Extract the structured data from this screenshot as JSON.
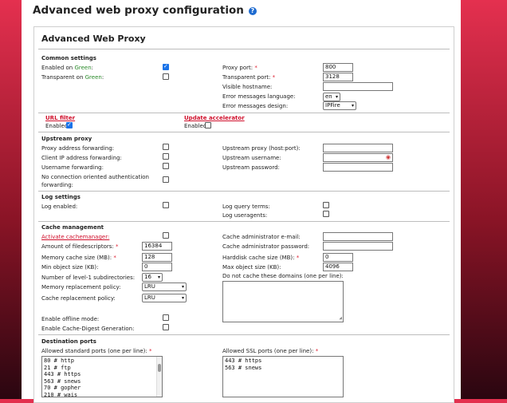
{
  "page": {
    "title": "Advanced web proxy configuration",
    "help_icon": "?"
  },
  "box_title": "Advanced Web Proxy",
  "common": {
    "heading": "Common settings",
    "enabled_on": "Enabled on ",
    "green_1": "Green",
    "colon_1": ":",
    "transparent_on": "Transparent on ",
    "green_2": "Green",
    "colon_2": ":",
    "proxy_port_label": "Proxy port:",
    "proxy_port": "800",
    "transparent_port_label": "Transparent port:",
    "transparent_port": "3128",
    "visible_hostname_label": "Visible hostname:",
    "visible_hostname": "",
    "err_lang_label": "Error messages language:",
    "err_lang": "en",
    "err_design_label": "Error messages design:",
    "err_design": "IPFire",
    "required_mark": "*"
  },
  "url_filter": {
    "label": "URL filter",
    "enabled": "Enabled"
  },
  "update_accel": {
    "label": "Update accelerator",
    "enabled": "Enabled"
  },
  "upstream": {
    "heading": "Upstream proxy",
    "addr_fwd": "Proxy address forwarding:",
    "client_ip_fwd": "Client IP address forwarding:",
    "user_fwd": "Username forwarding:",
    "no_conn_1": "No connection oriented authentication",
    "no_conn_2": "forwarding:",
    "proxy_label": "Upstream proxy (host:port):",
    "username_label": "Upstream username:",
    "password_label": "Upstream password:"
  },
  "log": {
    "heading": "Log settings",
    "enabled": "Log enabled:",
    "query_terms": "Log query terms:",
    "useragents": "Log useragents:"
  },
  "cache": {
    "heading": "Cache management",
    "activate": "Activate cachemanager:",
    "filedescriptors_label": "Amount of filedescriptors:",
    "filedescriptors": "16384",
    "mem_cache_label": "Memory cache size (MB):",
    "mem_cache": "128",
    "min_obj_label": "Min object size (KB):",
    "min_obj": "0",
    "l1_label": "Number of level-1 subdirectories:",
    "l1": "16",
    "mem_repl_label": "Memory replacement policy:",
    "mem_repl": "LRU",
    "cache_repl_label": "Cache replacement policy:",
    "cache_repl": "LRU",
    "admin_email_label": "Cache administrator e-mail:",
    "admin_pw_label": "Cache administrator password:",
    "hdd_label": "Harddisk cache size (MB):",
    "hdd": "0",
    "max_obj_label": "Max object size (KB):",
    "max_obj": "4096",
    "no_cache_label": "Do not cache these domains (one per line):",
    "offline_label": "Enable offline mode:",
    "digest_label": "Enable Cache-Digest Generation:"
  },
  "dest": {
    "heading": "Destination ports",
    "std_label": "Allowed standard ports (one per line):",
    "std_ports": "80 # http\n21 # ftp\n443 # https\n563 # snews\n70 # gopher\n210 # wais",
    "ssl_label": "Allowed SSL ports (one per line):",
    "ssl_ports": "443 # https\n563 # snews"
  },
  "colors": {
    "accent_red": "#d0102c",
    "green": "#2a8a2a",
    "checkbox_on": "#1a73e8"
  }
}
